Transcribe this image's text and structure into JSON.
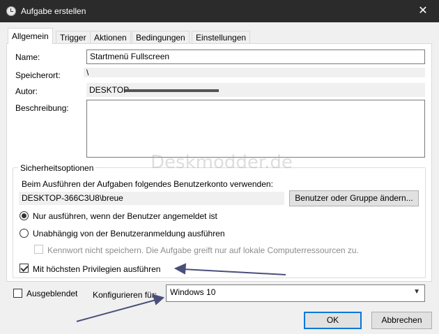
{
  "window": {
    "title": "Aufgabe erstellen",
    "close_glyph": "✕",
    "icon": "clock-icon"
  },
  "tabs": [
    {
      "label": "Allgemein",
      "active": true
    },
    {
      "label": "Trigger"
    },
    {
      "label": "Aktionen"
    },
    {
      "label": "Bedingungen"
    },
    {
      "label": "Einstellungen"
    }
  ],
  "general": {
    "name_label": "Name:",
    "name_value": "Startmenü Fullscreen",
    "location_label": "Speicherort:",
    "location_value": "\\",
    "author_label": "Autor:",
    "author_value": "DESKTOP-",
    "description_label": "Beschreibung:",
    "description_value": ""
  },
  "security": {
    "group_title": "Sicherheitsoptionen",
    "account_prompt": "Beim Ausführen der Aufgaben folgendes Benutzerkonto verwenden:",
    "account_value": "DESKTOP-366C3U8\\breue",
    "change_button": "Benutzer oder Gruppe ändern...",
    "radio_logged_on": "Nur ausführen, wenn der Benutzer angemeldet ist",
    "radio_independent": "Unabhängig von der Benutzeranmeldung ausführen",
    "no_password": "Kennwort nicht speichern. Die Aufgabe greift nur auf lokale Computerressourcen zu.",
    "highest_privileges": "Mit höchsten Privilegien ausführen"
  },
  "bottom": {
    "hidden_label": "Ausgeblendet",
    "configure_label": "Konfigurieren für:",
    "configure_value": "Windows 10",
    "ok_button": "OK",
    "cancel_button": "Abbrechen"
  },
  "watermark": "Deskmodder.de",
  "colors": {
    "titlebar": "#2b2b2b",
    "accent": "#0078d7",
    "arrow": "#4a4f7a"
  }
}
